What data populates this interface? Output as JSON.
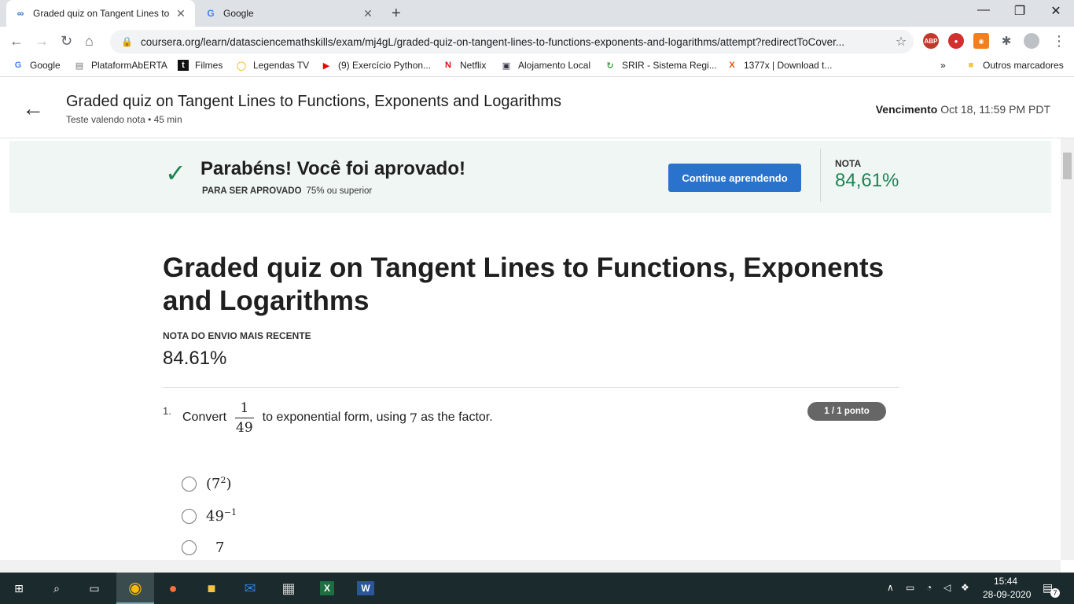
{
  "browser": {
    "tabs": [
      {
        "title": "Graded quiz on Tangent Lines to",
        "active": true,
        "favicon": "coursera-icon"
      },
      {
        "title": "Google",
        "active": false,
        "favicon": "google-icon"
      }
    ],
    "url": "coursera.org/learn/datasciencemathskills/exam/mj4gL/graded-quiz-on-tangent-lines-to-functions-exponents-and-logarithms/attempt?redirectToCover...",
    "extensions": [
      "ABP",
      "",
      "",
      "",
      ""
    ],
    "bookmarks": [
      "Google",
      "PlataformAbERTA",
      "Filmes",
      "Legendas TV",
      "(9) Exercício Python...",
      "Netflix",
      "Alojamento Local",
      "SRIR - Sistema Regi...",
      "1377x | Download t...",
      "»",
      "Outros marcadores"
    ]
  },
  "header": {
    "title": "Graded quiz on Tangent Lines to Functions, Exponents and Logarithms",
    "subtitle": "Teste valendo nota • 45 min",
    "due_label": "Vencimento",
    "due_value": "Oct 18, 11:59 PM PDT"
  },
  "banner": {
    "message": "Parabéns! Você foi aprovado!",
    "req_label": "PARA SER APROVADO",
    "req_value": "75% ou superior",
    "cta": "Continue aprendendo",
    "grade_label": "NOTA",
    "grade_value": "84,61%"
  },
  "content": {
    "title": "Graded quiz on Tangent Lines to Functions, Exponents and Logarithms",
    "recent_label": "NOTA DO ENVIO MAIS RECENTE",
    "recent_value": "84.61%"
  },
  "question": {
    "number": "1.",
    "prefix": "Convert",
    "frac_num": "1",
    "frac_den": "49",
    "middle": "to exponential form, using",
    "factor": "7",
    "suffix": "as the factor.",
    "points": "1 / 1 ponto",
    "options": [
      {
        "base": "(7",
        "exp": "2",
        "close": ")"
      },
      {
        "base": "49",
        "exp": "−1",
        "close": ""
      },
      {
        "base": "7",
        "exp": "",
        "close": ""
      }
    ]
  },
  "taskbar": {
    "time": "15:44",
    "date": "28-09-2020",
    "notif_count": "7"
  }
}
